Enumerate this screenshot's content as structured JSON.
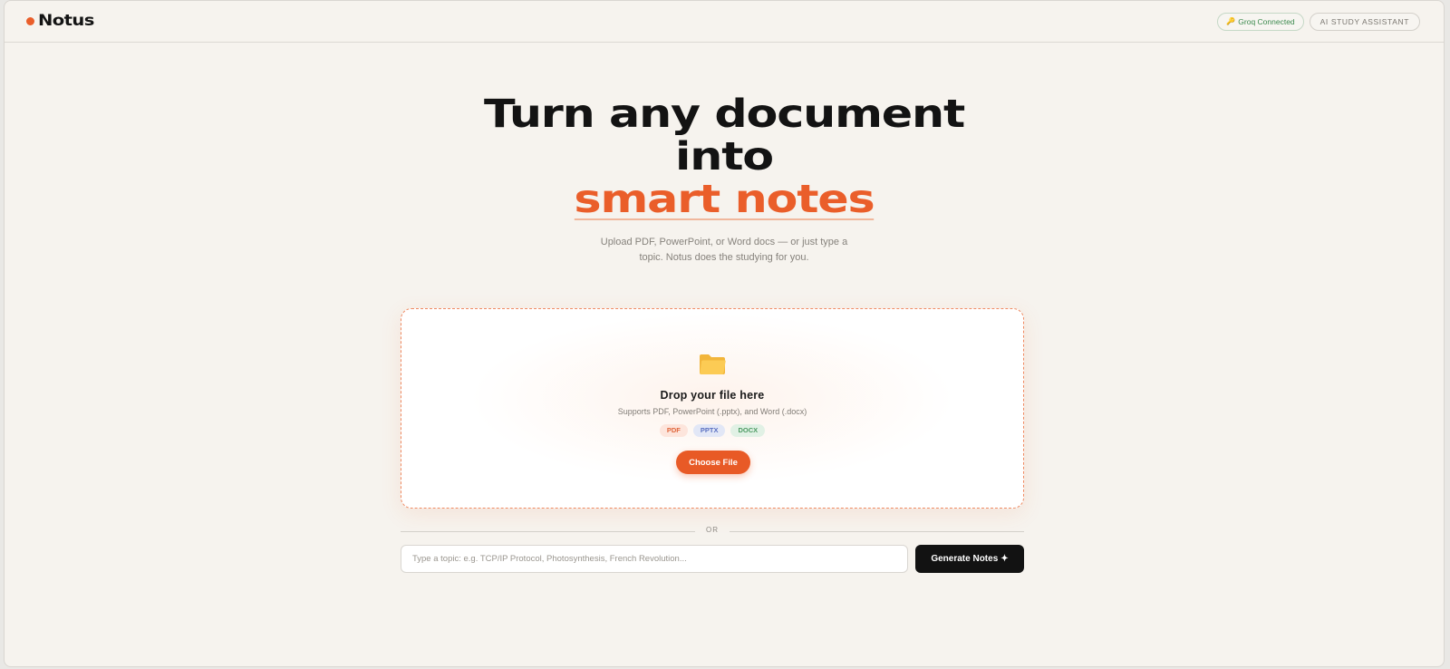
{
  "brand": {
    "name": "Notus",
    "accent": "#ea5e2a"
  },
  "header": {
    "status_pill": {
      "icon": "key-icon",
      "label": "Groq Connected"
    },
    "assistant_pill": {
      "label": "AI STUDY ASSISTANT"
    }
  },
  "hero": {
    "line1": "Turn any document",
    "line2": "into",
    "accent": "smart notes",
    "subtitle_line1": "Upload PDF, PowerPoint, or Word docs — or just type a",
    "subtitle_line2": "topic. Notus does the studying for you."
  },
  "dropzone": {
    "icon": "folder-icon",
    "title": "Drop your file here",
    "subtitle": "Supports PDF, PowerPoint (.pptx), and Word (.docx)",
    "badges": [
      "PDF",
      "PPTX",
      "DOCX"
    ],
    "button_label": "Choose File"
  },
  "divider": {
    "label": "OR"
  },
  "topic": {
    "placeholder": "Type a topic: e.g. TCP/IP Protocol, Photosynthesis, French Revolution...",
    "value": ""
  },
  "generate": {
    "label": "Generate Notes",
    "icon": "sparkle-icon"
  }
}
